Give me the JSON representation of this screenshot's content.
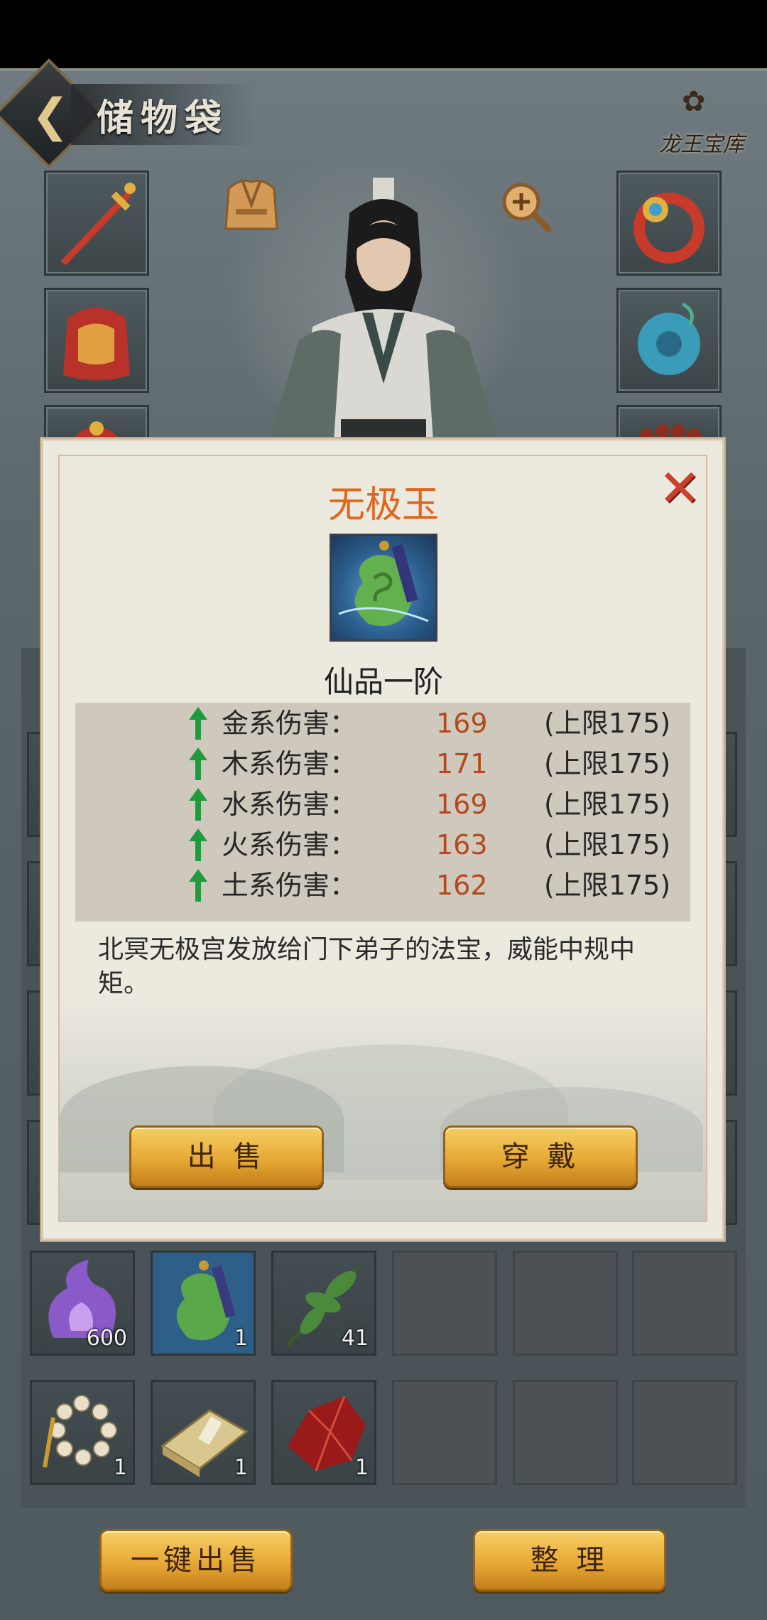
{
  "header": {
    "title": "储物袋",
    "logo_text": "龙王宝库"
  },
  "inventory": {
    "row_a": [
      {
        "name": "purple-flame-item",
        "count": "600"
      },
      {
        "name": "jade-pendant-item",
        "count": "1"
      },
      {
        "name": "herb-leaf-item",
        "count": "41"
      }
    ],
    "row_b": [
      {
        "name": "prayer-beads-item",
        "count": "1"
      },
      {
        "name": "book-item",
        "count": "1"
      },
      {
        "name": "red-crystal-item",
        "count": "1"
      }
    ]
  },
  "bottom": {
    "sell_all_label": "一键出售",
    "sort_label": "整 理"
  },
  "dialog": {
    "title": "无极玉",
    "grade": "仙品一阶",
    "stats": [
      {
        "label": "金系伤害：",
        "value": "169",
        "max": "(上限175)"
      },
      {
        "label": "木系伤害：",
        "value": "171",
        "max": "(上限175)"
      },
      {
        "label": "水系伤害：",
        "value": "169",
        "max": "(上限175)"
      },
      {
        "label": "火系伤害：",
        "value": "163",
        "max": "(上限175)"
      },
      {
        "label": "土系伤害：",
        "value": "162",
        "max": "(上限175)"
      }
    ],
    "description": "北冥无极宫发放给门下弟子的法宝，威能中规中矩。",
    "sell_label": "出 售",
    "equip_label": "穿 戴"
  }
}
